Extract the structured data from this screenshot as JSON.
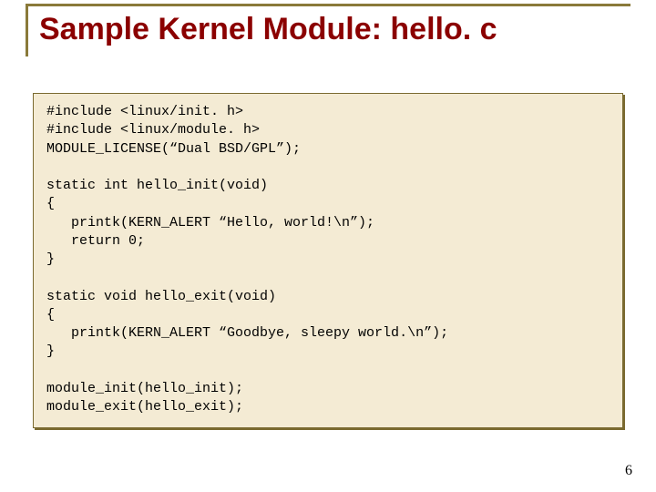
{
  "slide": {
    "title": "Sample Kernel Module: hello. c",
    "page_number": "6"
  },
  "code": {
    "lines": [
      "#include <linux/init. h>",
      "#include <linux/module. h>",
      "MODULE_LICENSE(“Dual BSD/GPL”);",
      "",
      "static int hello_init(void)",
      "{",
      "   printk(KERN_ALERT “Hello, world!\\n”);",
      "   return 0;",
      "}",
      "",
      "static void hello_exit(void)",
      "{",
      "   printk(KERN_ALERT “Goodbye, sleepy world.\\n”);",
      "}",
      "",
      "module_init(hello_init);",
      "module_exit(hello_exit);"
    ]
  }
}
